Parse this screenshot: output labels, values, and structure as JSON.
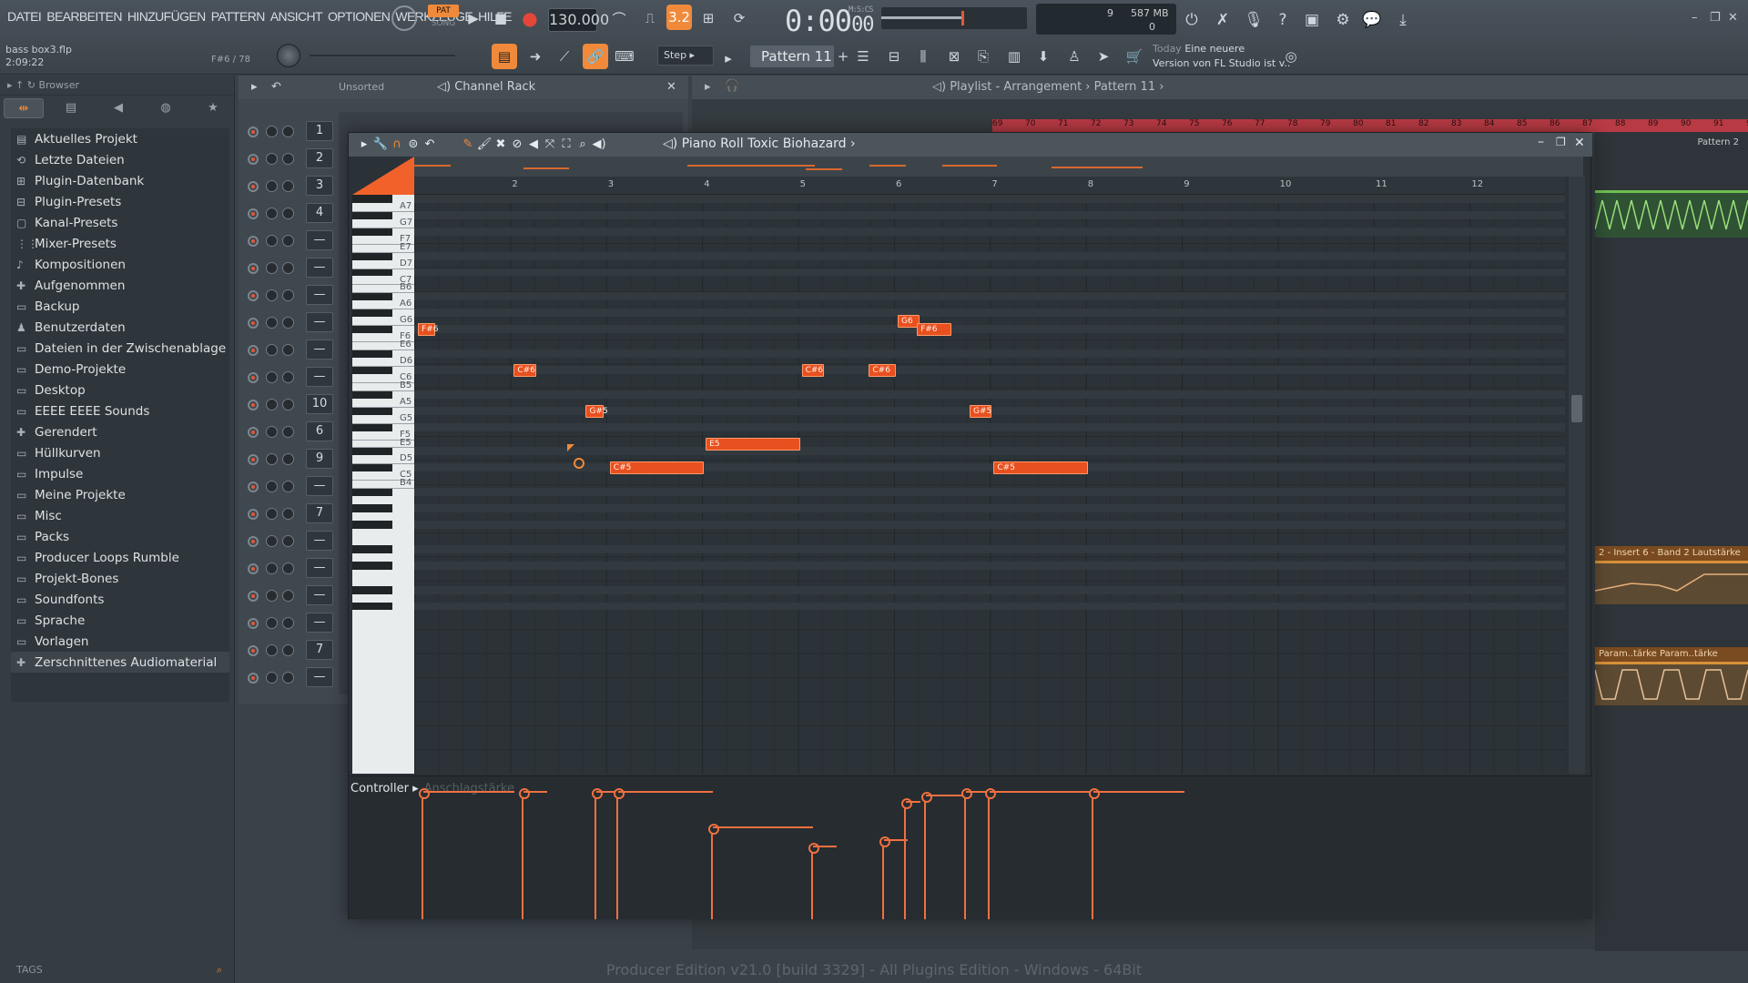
{
  "menu": [
    "DATEI",
    "BEARBEITEN",
    "HINZUFÜGEN",
    "PATTERN",
    "ANSICHT",
    "OPTIONEN",
    "WERKZEUGE",
    "HILFE"
  ],
  "transport": {
    "pat": "PAT",
    "song": "SONG",
    "tempo": "130.000",
    "time": "0:00",
    "time_sub": "00",
    "mscs": "M:S:CS"
  },
  "cpu": {
    "val1": "9",
    "mem": "587 MB",
    "val2": "0"
  },
  "hint": {
    "file": "bass box3.flp",
    "pos": "2:09:22",
    "note": "F#6 / 78"
  },
  "toolbar": {
    "step": "Step",
    "pattern": "Pattern 11"
  },
  "news": {
    "day": "Today",
    "line1": "Eine neuere",
    "line2": "Version von FL Studio ist v.."
  },
  "browser": {
    "title": "Browser",
    "items": [
      "Aktuelles Projekt",
      "Letzte Dateien",
      "Plugin-Datenbank",
      "Plugin-Presets",
      "Kanal-Presets",
      "Mixer-Presets",
      "Kompositionen",
      "Aufgenommen",
      "Backup",
      "Benutzerdaten",
      "Dateien in der Zwischenablage",
      "Demo-Projekte",
      "Desktop",
      "EEEE EEEE Sounds",
      "Gerendert",
      "Hüllkurven",
      "Impulse",
      "Meine Projekte",
      "Misc",
      "Packs",
      "Producer Loops Rumble",
      "Projekt-Bones",
      "Soundfonts",
      "Sprache",
      "Vorlagen",
      "Zerschnittenes Audiomaterial"
    ],
    "tags": "TAGS"
  },
  "channel_rack": {
    "sort": "Unsorted",
    "title": "Channel Rack",
    "numbers": [
      "1",
      "2",
      "3",
      "4",
      "—",
      "—",
      "—",
      "—",
      "—",
      "—",
      "10",
      "6",
      "9",
      "—",
      "7",
      "—",
      "—",
      "—",
      "—",
      "7",
      "—"
    ]
  },
  "playlist": {
    "title": "Playlist - Arrangement",
    "pattern": "Pattern 11",
    "ruler": [
      "69",
      "70",
      "71",
      "72",
      "73",
      "74",
      "75",
      "76",
      "77",
      "78",
      "79",
      "80",
      "81",
      "82",
      "83",
      "84",
      "85",
      "86",
      "87",
      "88",
      "89",
      "90",
      "91",
      "92"
    ],
    "clip_labels": [
      "Pattern 2",
      "2 - Insert 6 - Band 2 Lautstärke",
      "Param..tärke",
      "Param..tärke"
    ]
  },
  "piano_roll": {
    "title": "Piano Roll Toxic Biohazard",
    "bars": [
      "2",
      "3",
      "4",
      "5",
      "6",
      "7",
      "8",
      "9",
      "10",
      "11",
      "12"
    ],
    "key_labels": [
      "A7",
      "G7",
      "F7",
      "E7",
      "D7",
      "C7",
      "B6",
      "A6",
      "G6",
      "F6",
      "E6",
      "D6",
      "C6",
      "B5",
      "A5",
      "G5",
      "F5",
      "E5",
      "D5",
      "C5",
      "B4"
    ],
    "notes": [
      "F#6",
      "C#6",
      "G#5",
      "E5",
      "C#5",
      "C#6",
      "C#6",
      "G6",
      "F#6",
      "G#5",
      "C#5"
    ],
    "controller": "Controller",
    "controller_sub": "Anschlagstärke",
    "velocities": [
      1.0,
      1.0,
      1.0,
      1.0,
      0.72,
      0.57,
      0.62,
      0.92,
      0.97,
      1.0,
      1.0,
      1.0
    ]
  },
  "status": "Producer Edition v21.0 [build 3329] - All Plugins Edition - Windows - 64Bit"
}
